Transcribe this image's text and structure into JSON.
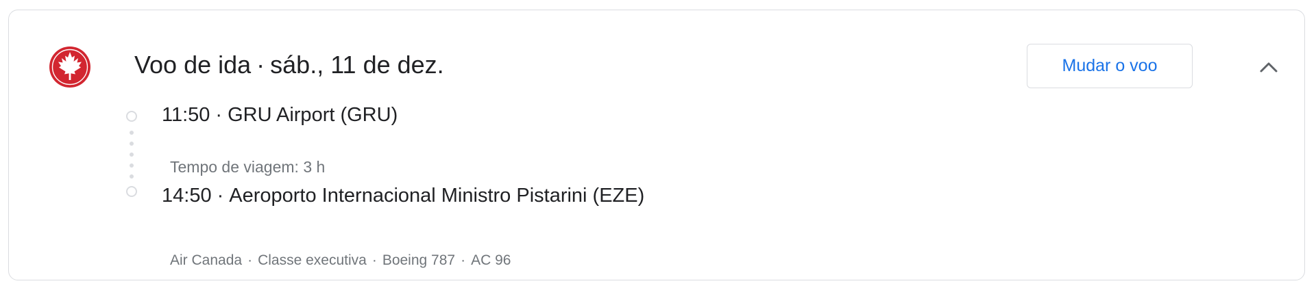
{
  "header": {
    "title": "Voo de ida",
    "separator": "·",
    "date": "sáb., 11 de dez.",
    "change_button": "Mudar o voo",
    "airline_logo_icon": "maple-leaf-icon",
    "collapse_icon": "chevron-up-icon"
  },
  "itinerary": {
    "departure": {
      "time": "11:50",
      "separator": "·",
      "airport": "GRU Airport (GRU)"
    },
    "travel_time": "Tempo de viagem: 3 h",
    "arrival": {
      "time": "14:50",
      "separator": "·",
      "airport": "Aeroporto Internacional Ministro Pistarini (EZE)"
    }
  },
  "details": {
    "airline": "Air Canada",
    "cabin": "Classe executiva",
    "aircraft": "Boeing 787",
    "flight_number": "AC 96",
    "separator": "·"
  },
  "colors": {
    "brand_red": "#d22630",
    "accent_blue": "#1a73e8",
    "text_primary": "#202124",
    "text_secondary": "#70757a",
    "border": "#dadce0"
  }
}
